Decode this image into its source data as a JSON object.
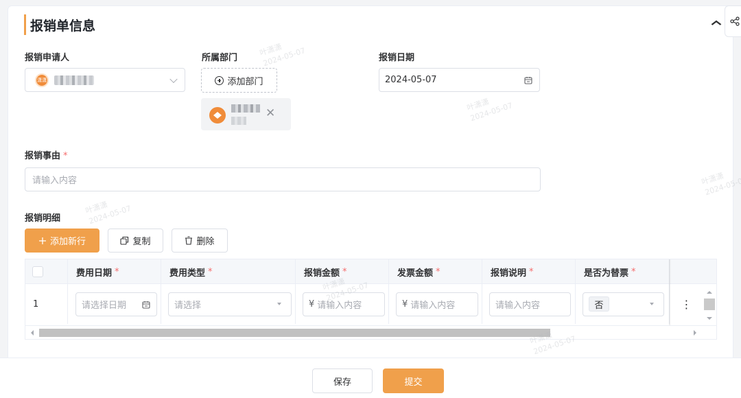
{
  "section": {
    "title": "报销单信息"
  },
  "fields": {
    "applicant_label": "报销申请人",
    "applicant_avatar_text": "潇潇",
    "department_label": "所属部门",
    "add_department_label": "添加部门",
    "date_label": "报销日期",
    "date_value": "2024-05-07",
    "reason_label": "报销事由",
    "reason_required": "*",
    "reason_placeholder": "请输入内容",
    "details_label": "报销明细"
  },
  "toolbar": {
    "add_row_label": "添加新行",
    "copy_label": "复制",
    "delete_label": "删除"
  },
  "table": {
    "required_mark": "*",
    "columns": [
      "费用日期",
      "费用类型",
      "报销金额",
      "发票金额",
      "报销说明",
      "是否为替票"
    ],
    "rows": [
      {
        "index": "1",
        "date_placeholder": "请选择日期",
        "type_placeholder": "请选择",
        "currency_symbol": "¥",
        "amount_placeholder": "请输入内容",
        "invoice_placeholder": "请输入内容",
        "desc_placeholder": "请输入内容",
        "substitute_value": "否",
        "more_icon": "⋮"
      }
    ]
  },
  "footer": {
    "save_label": "保存",
    "submit_label": "提交"
  },
  "watermark": {
    "name": "叶潇潇",
    "date": "2024-05-07"
  },
  "colors": {
    "accent": "#f0a04b",
    "required": "#f56c6c",
    "border": "#dcdfe6"
  },
  "icons": {
    "collapse": "chevron-up-icon",
    "share": "share-icon",
    "calendar": "calendar-icon",
    "plus": "plus-icon",
    "copy": "copy-icon",
    "delete": "trash-icon",
    "more": "more-vertical-icon"
  }
}
